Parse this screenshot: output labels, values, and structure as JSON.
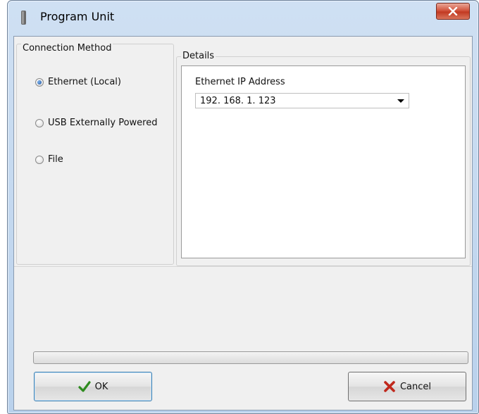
{
  "window": {
    "title": "Program Unit",
    "close_label": "x"
  },
  "connection_method": {
    "legend": "Connection Method",
    "options": [
      {
        "label": "Ethernet (Local)",
        "selected": true
      },
      {
        "label": "USB Externally Powered",
        "selected": false
      },
      {
        "label": "File",
        "selected": false
      }
    ]
  },
  "details": {
    "legend": "Details",
    "ip_label": "Ethernet IP Address",
    "ip_value": "192. 168. 1. 123"
  },
  "progress": {
    "fraction": 0.0
  },
  "buttons": {
    "ok_label": "OK",
    "cancel_label": "Cancel"
  },
  "colors": {
    "ok_check": "#2e8b1e",
    "cancel_x": "#c0281c",
    "radio_selected": "#1a4f9c"
  },
  "icons": {
    "app": "app-icon",
    "close": "close-icon",
    "ok": "checkmark-icon",
    "cancel": "red-x-icon",
    "dropdown": "chevron-down-icon"
  }
}
